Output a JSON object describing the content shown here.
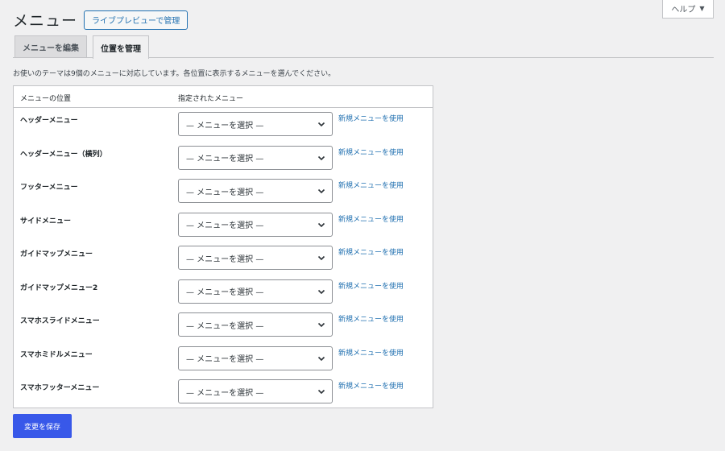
{
  "help": {
    "label": "ヘルプ",
    "caret": "▼"
  },
  "header": {
    "title": "メニュー",
    "live_preview_label": "ライブプレビューで管理"
  },
  "tabs": [
    {
      "label": "メニューを編集",
      "active": false
    },
    {
      "label": "位置を管理",
      "active": true
    }
  ],
  "description": "お使いのテーマは9個のメニューに対応しています。各位置に表示するメニューを選んでください。",
  "table": {
    "col_location": "メニューの位置",
    "col_menu": "指定されたメニュー",
    "rows": [
      {
        "location": "ヘッダーメニュー",
        "selected": "— メニューを選択 —",
        "link": "新規メニューを使用"
      },
      {
        "location": "ヘッダーメニュー（横列）",
        "selected": "— メニューを選択 —",
        "link": "新規メニューを使用"
      },
      {
        "location": "フッターメニュー",
        "selected": "— メニューを選択 —",
        "link": "新規メニューを使用"
      },
      {
        "location": "サイドメニュー",
        "selected": "— メニューを選択 —",
        "link": "新規メニューを使用"
      },
      {
        "location": "ガイドマップメニュー",
        "selected": "— メニューを選択 —",
        "link": "新規メニューを使用"
      },
      {
        "location": "ガイドマップメニュー2",
        "selected": "— メニューを選択 —",
        "link": "新規メニューを使用"
      },
      {
        "location": "スマホスライドメニュー",
        "selected": "— メニューを選択 —",
        "link": "新規メニューを使用"
      },
      {
        "location": "スマホミドルメニュー",
        "selected": "— メニューを選択 —",
        "link": "新規メニューを使用"
      },
      {
        "location": "スマホフッターメニュー",
        "selected": "— メニューを選択 —",
        "link": "新規メニューを使用"
      }
    ]
  },
  "save_label": "変更を保存",
  "colors": {
    "accent": "#2271b1",
    "primary_button": "#3858e9",
    "background": "#f0f0f1"
  }
}
